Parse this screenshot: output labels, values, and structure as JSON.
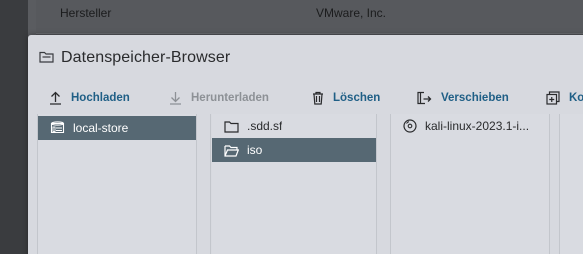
{
  "background": {
    "row_key": "Hersteller",
    "row_value": "VMware, Inc."
  },
  "dialog": {
    "title": "Datenspeicher-Browser",
    "title_icon": "folder-icon"
  },
  "toolbar": {
    "upload": "Hochladen",
    "download": "Herunterladen",
    "delete": "Löschen",
    "move": "Verschieben",
    "copy": "Ko"
  },
  "columns": {
    "datastores": [
      {
        "label": "local-store",
        "icon": "datastore-icon",
        "selected": true
      }
    ],
    "folders": [
      {
        "label": ".sdd.sf",
        "icon": "folder-icon",
        "selected": false
      },
      {
        "label": "iso",
        "icon": "folder-open-icon",
        "selected": true
      }
    ],
    "files": [
      {
        "label": "kali-linux-2023.1-i...",
        "icon": "disc-icon",
        "selected": false
      }
    ]
  },
  "colors": {
    "accent": "#1f5f86",
    "selected_bg": "#566873",
    "dialog_bg": "#d7d9df",
    "disabled": "#8d9196"
  }
}
